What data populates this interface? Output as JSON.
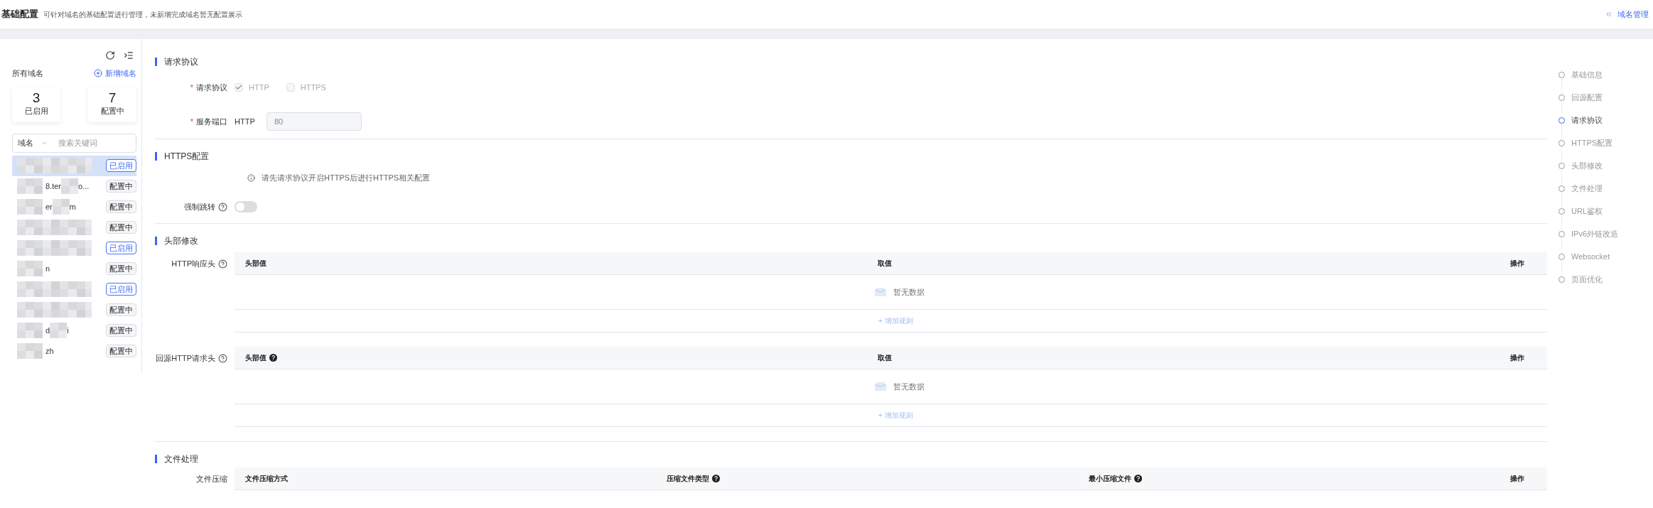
{
  "header": {
    "title": "基础配置",
    "description": "可针对域名的基础配置进行管理，未新增完成域名暂无配置展示",
    "back_link": "域名管理"
  },
  "sidebar": {
    "title": "所有域名",
    "add_button": "新增域名",
    "stats": [
      {
        "value": "3",
        "label": "已启用"
      },
      {
        "value": "7",
        "label": "配置中"
      }
    ],
    "search": {
      "field": "域名",
      "placeholder": "搜索关键词"
    },
    "domains": [
      {
        "status": "已启用",
        "kind": "enabled",
        "selected": true
      },
      {
        "fragments": [
          "8.ter",
          "o..."
        ],
        "status": "配置中",
        "kind": "configuring",
        "selected": false
      },
      {
        "fragments": [
          "er",
          "m"
        ],
        "status": "配置中",
        "kind": "configuring",
        "selected": false
      },
      {
        "status": "配置中",
        "kind": "configuring",
        "selected": false
      },
      {
        "status": "已启用",
        "kind": "enabled",
        "selected": false
      },
      {
        "fragments": [
          "n"
        ],
        "status": "配置中",
        "kind": "configuring",
        "selected": false
      },
      {
        "status": "已启用",
        "kind": "enabled",
        "selected": false
      },
      {
        "status": "配置中",
        "kind": "configuring",
        "selected": false
      },
      {
        "fragments": [
          "d",
          "i"
        ],
        "status": "配置中",
        "kind": "configuring",
        "selected": false
      },
      {
        "fragments": [
          "zh"
        ],
        "status": "配置中",
        "kind": "configuring",
        "selected": false
      }
    ]
  },
  "sections": [
    {
      "title": "请求协议",
      "fields": [
        {
          "kind": "checkboxes",
          "label": "请求协议",
          "required_mark": "*",
          "options": [
            {
              "label": "HTTP",
              "checked": true,
              "disabled": true
            },
            {
              "label": "HTTPS",
              "checked": false,
              "disabled": true
            }
          ]
        },
        {
          "kind": "port",
          "label": "服务端口",
          "required_mark": "*",
          "protocol": "HTTP",
          "value": "80"
        }
      ]
    },
    {
      "title": "HTTPS配置",
      "fields": [
        {
          "kind": "info",
          "text": "请先请求协议开启HTTPS后进行HTTPS相关配置"
        },
        {
          "kind": "switch",
          "label": "强制跳转",
          "help": true,
          "on": false
        }
      ]
    },
    {
      "title": "头部修改",
      "fields": [
        {
          "kind": "table",
          "label": "HTTP响应头",
          "help": true,
          "columns": [
            {
              "label": "头部值",
              "help": false
            },
            {
              "label": "取值",
              "help": false
            },
            {
              "label": "操作",
              "help": false
            }
          ],
          "empty_text": "暂无数据",
          "add_link": "+ 增加规则"
        },
        {
          "kind": "table",
          "label": "回源HTTP请求头",
          "help": true,
          "columns": [
            {
              "label": "头部值",
              "help": true
            },
            {
              "label": "取值",
              "help": false
            },
            {
              "label": "操作",
              "help": false
            }
          ],
          "empty_text": "暂无数据",
          "add_link": "+ 增加规则"
        }
      ]
    },
    {
      "title": "文件处理",
      "fields": [
        {
          "kind": "table",
          "label": "文件压缩",
          "help": false,
          "columns": [
            {
              "label": "文件压缩方式",
              "help": false
            },
            {
              "label": "压缩文件类型",
              "help": true
            },
            {
              "label": "最小压缩文件",
              "help": true
            },
            {
              "label": "操作",
              "help": false
            }
          ]
        }
      ]
    }
  ],
  "anchor_nav": [
    {
      "label": "基础信息",
      "selected": false
    },
    {
      "label": "回源配置",
      "selected": false
    },
    {
      "label": "请求协议",
      "selected": true
    },
    {
      "label": "HTTPS配置",
      "selected": false
    },
    {
      "label": "头部修改",
      "selected": false
    },
    {
      "label": "文件处理",
      "selected": false
    },
    {
      "label": "URL鉴权",
      "selected": false
    },
    {
      "label": "IPv6外链改造",
      "selected": false
    },
    {
      "label": "Websocket",
      "selected": false
    },
    {
      "label": "页面优化",
      "selected": false
    }
  ]
}
